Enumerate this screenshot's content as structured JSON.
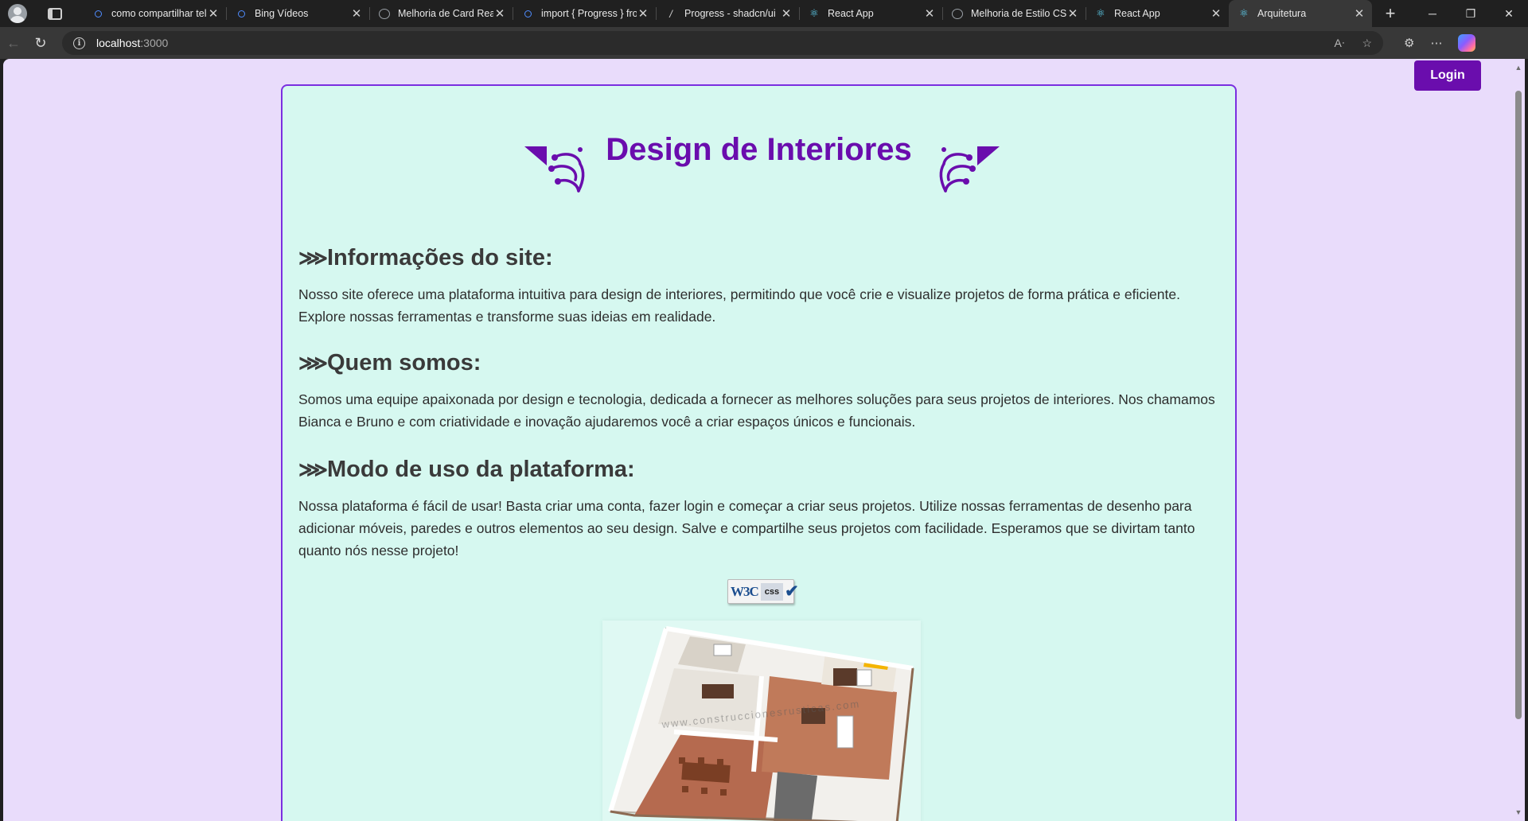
{
  "browser": {
    "tabs": [
      {
        "title": "como compartilhar tel",
        "icon": "search-icon"
      },
      {
        "title": "Bing Vídeos",
        "icon": "search-icon"
      },
      {
        "title": "Melhoria de Card Reac",
        "icon": "globe-icon"
      },
      {
        "title": "import { Progress } fro",
        "icon": "search-icon"
      },
      {
        "title": "Progress - shadcn/ui",
        "icon": "slash-icon"
      },
      {
        "title": "React App",
        "icon": "react-icon"
      },
      {
        "title": "Melhoria de Estilo CSS",
        "icon": "globe-icon"
      },
      {
        "title": "React App",
        "icon": "react-icon"
      },
      {
        "title": "Arquitetura",
        "icon": "react-icon",
        "active": true
      }
    ],
    "url_host": "localhost",
    "url_port": ":3000"
  },
  "page": {
    "login_label": "Login",
    "title": "Design de Interiores",
    "sections": [
      {
        "heading": "Informações do site:",
        "body": "Nosso site oferece uma plataforma intuitiva para design de interiores, permitindo que você crie e visualize projetos de forma prática e eficiente. Explore nossas ferramentas e transforme suas ideias em realidade."
      },
      {
        "heading": "Quem somos:",
        "body": "Somos uma equipe apaixonada por design e tecnologia, dedicada a fornecer as melhores soluções para seus projetos de interiores. Nos chamamos Bianca e Bruno e com criatividade e inovação ajudaremos você a criar espaços únicos e funcionais."
      },
      {
        "heading": "Modo de uso da plataforma:",
        "body": "Nossa plataforma é fácil de usar! Basta criar uma conta, fazer login e começar a criar seus projetos. Utilize nossas ferramentas de desenho para adicionar móveis, paredes e outros elementos ao seu design. Salve e compartilhe seus projetos com facilidade. Esperamos que se divirtam tanto quanto nós nesse projeto!"
      }
    ],
    "badge": {
      "mark": "W3C",
      "label": "css"
    },
    "image_watermark": "www.construccionesrusticas.com"
  },
  "colors": {
    "accent": "#6a0dad",
    "page_bg": "#e9dcfb",
    "card_bg": "#d6f8f0",
    "card_border": "#7b2fe0"
  }
}
